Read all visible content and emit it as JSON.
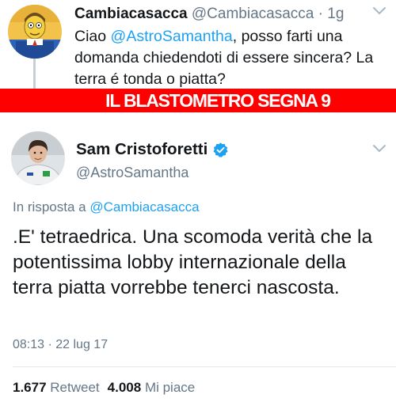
{
  "reply_tweet": {
    "display_name": "Cambiacasacca",
    "handle": "@Cambiacasacca",
    "time": "· 1g",
    "text_before": "Ciao ",
    "mention": "@AstroSamantha",
    "text_after": ", posso farti una domanda chiedendoti di essere sincera? La terra é tonda o piatta?"
  },
  "banner": {
    "text": "IL BLASTOMETRO SEGNA 9",
    "color": "#ff0000"
  },
  "main_tweet": {
    "display_name": "Sam Cristoforetti",
    "handle": "@AstroSamantha",
    "reply_label": "In risposta a ",
    "reply_mention": "@Cambiacasacca",
    "text": ".E' tetraedrica. Una scomoda verità che la potentissima lobby internazionale della terra piatta vorrebbe tenerci nascosta.",
    "timestamp": "08:13 · 22 lug 17",
    "retweets_count": "1.677",
    "retweets_label": "Retweet",
    "likes_count": "4.008",
    "likes_label": "Mi piace"
  },
  "icons": {
    "reply_avatar": "cartoon-avatar-icon",
    "main_avatar": "astronaut-avatar-icon",
    "verified": "verified-badge-icon",
    "menu": "chevron-down-icon"
  },
  "colors": {
    "link": "#1da1f2",
    "secondary_text": "#657786",
    "verified": "#1da1f2"
  }
}
